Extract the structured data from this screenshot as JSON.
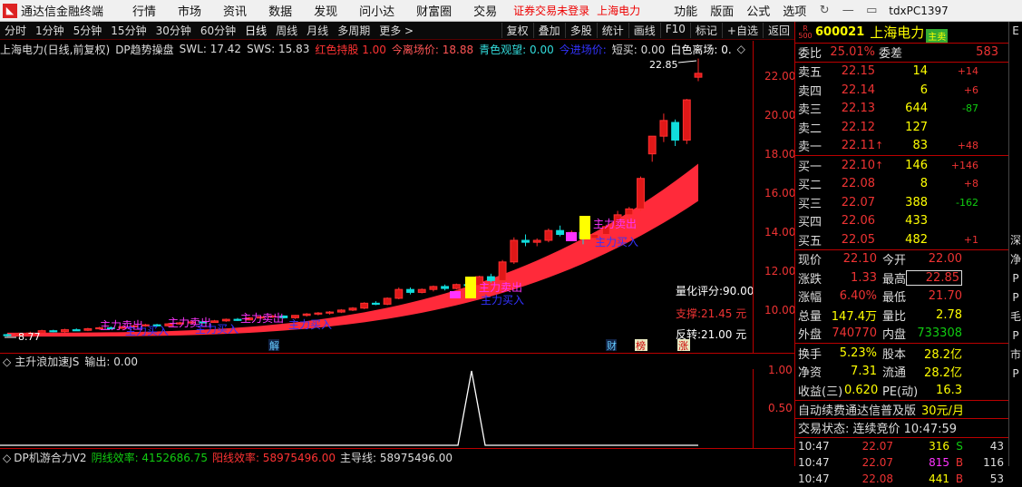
{
  "titlebar": {
    "app_title": "通达信金融终端",
    "menu": [
      "行情",
      "市场",
      "资讯",
      "数据",
      "发现",
      "问小达",
      "财富圈",
      "交易"
    ],
    "warn": "证券交易未登录",
    "stock": "上海电力",
    "right_menu": [
      "功能",
      "版面",
      "公式",
      "选项"
    ],
    "account": "tdxPC1397"
  },
  "timeframes": [
    "分时",
    "1分钟",
    "5分钟",
    "15分钟",
    "30分钟",
    "60分钟",
    "日线",
    "周线",
    "月线",
    "多周期",
    "更多 >"
  ],
  "active_timeframe": "日线",
  "toolbar_right": [
    "复权",
    "叠加",
    "多股",
    "统计",
    "画线",
    "F10",
    "标记",
    "+自选",
    "返回"
  ],
  "chart_info": {
    "name": "上海电力(日线,前复权)",
    "indicator": "DP趋势操盘",
    "swl": "SWL: 17.42",
    "sws": "SWS: 15.83",
    "red_hold": "红色持股  1.00",
    "exit_price": "今离场价: 18.88",
    "cyan_watch": "青色观望: 0.00",
    "entry": "今进场价: ",
    "short_buy": "短买: 0.00",
    "white_exit": "白色离场: 0."
  },
  "price_axis": [
    "22.00",
    "20.00",
    "18.00",
    "16.00",
    "14.00",
    "12.00",
    "10.00"
  ],
  "chart_labels": {
    "peak": "22.85",
    "low": "8.77",
    "score": "量化评分:90.00",
    "support": "支撑:21.45 元",
    "reversal": "反转:21.00 元",
    "main_sell": "主力卖出",
    "main_buy": "主力买入",
    "badges": [
      "解",
      "财",
      "榜",
      "涨"
    ]
  },
  "mid": {
    "name": "主升浪加速JS",
    "output": "输出: 0.00"
  },
  "sub_axis": [
    "1.00",
    "0.50"
  ],
  "bottom": {
    "name": "DP机游合力V2",
    "yin": "阴线效率: 4152686.75",
    "yang": "阳线效率: 58975496.00",
    "main": "主导线: 58975496.00"
  },
  "quote": {
    "r_badge": "R\n500",
    "code": "600021",
    "name": "上海电力",
    "tag": "主卖",
    "weibi_label": "委比",
    "weibi": "25.01%",
    "weicha_label": "委差",
    "weicha": "583",
    "asks": [
      {
        "label": "卖五",
        "price": "22.15",
        "vol": "14",
        "chg": "+14"
      },
      {
        "label": "卖四",
        "price": "22.14",
        "vol": "6",
        "chg": "+6"
      },
      {
        "label": "卖三",
        "price": "22.13",
        "vol": "644",
        "chg": "-87"
      },
      {
        "label": "卖二",
        "price": "22.12",
        "vol": "127",
        "chg": ""
      },
      {
        "label": "卖一",
        "price": "22.11",
        "vol": "83",
        "chg": "+48"
      }
    ],
    "bids": [
      {
        "label": "买一",
        "price": "22.10",
        "vol": "146",
        "chg": "+146"
      },
      {
        "label": "买二",
        "price": "22.08",
        "vol": "8",
        "chg": "+8"
      },
      {
        "label": "买三",
        "price": "22.07",
        "vol": "388",
        "chg": "-162"
      },
      {
        "label": "买四",
        "price": "22.06",
        "vol": "433",
        "chg": ""
      },
      {
        "label": "买五",
        "price": "22.05",
        "vol": "482",
        "chg": "+1"
      }
    ],
    "stats": [
      {
        "a": "现价",
        "b": "22.10",
        "c": "今开",
        "d": "22.00"
      },
      {
        "a": "涨跌",
        "b": "1.33",
        "c": "最高",
        "d": "22.85"
      },
      {
        "a": "涨幅",
        "b": "6.40%",
        "c": "最低",
        "d": "21.70"
      },
      {
        "a": "总量",
        "b": "147.4万",
        "c": "量比",
        "d": "2.78"
      },
      {
        "a": "外盘",
        "b": "740770",
        "c": "内盘",
        "d": "733308"
      }
    ],
    "stats2": [
      {
        "a": "换手",
        "b": "5.23%",
        "c": "股本",
        "d": "28.2亿"
      },
      {
        "a": "净资",
        "b": "7.31",
        "c": "流通",
        "d": "28.2亿"
      },
      {
        "a": "收益(三)",
        "b": "0.620",
        "c": "PE(动)",
        "d": "16.3"
      }
    ],
    "promo": "自动续费通达信普及版",
    "promo_price": "30元/月",
    "trade_status": "交易状态: 连续竞价 10:47:59",
    "ticks": [
      {
        "t": "10:47",
        "p": "22.07",
        "v": "316",
        "s": "S",
        "n": "43"
      },
      {
        "t": "10:47",
        "p": "22.07",
        "v": "815",
        "s": "B",
        "n": "116"
      },
      {
        "t": "10:47",
        "p": "22.08",
        "v": "441",
        "s": "B",
        "n": "53"
      }
    ]
  },
  "edge_chars": [
    "E",
    "",
    "",
    "",
    "",
    "",
    "",
    "",
    "",
    "",
    "",
    "深",
    "净",
    "P",
    "P",
    "毛",
    "P",
    "市",
    "P"
  ],
  "chart_data": {
    "type": "candlestick",
    "ylim": [
      8.4,
      23.0
    ],
    "candles": [
      [
        8.8,
        8.85,
        8.7,
        8.77
      ],
      [
        8.78,
        8.9,
        8.72,
        8.86
      ],
      [
        8.85,
        8.95,
        8.8,
        8.88
      ],
      [
        8.88,
        9.05,
        8.85,
        9.0
      ],
      [
        9.0,
        9.05,
        8.92,
        8.95
      ],
      [
        8.95,
        9.1,
        8.9,
        9.05
      ],
      [
        9.05,
        9.12,
        9.0,
        9.02
      ],
      [
        9.02,
        9.15,
        8.98,
        9.1
      ],
      [
        9.1,
        9.2,
        9.05,
        9.15
      ],
      [
        9.15,
        9.22,
        9.08,
        9.12
      ],
      [
        9.12,
        9.25,
        9.1,
        9.2
      ],
      [
        9.2,
        9.3,
        9.15,
        9.25
      ],
      [
        9.25,
        9.35,
        9.2,
        9.3
      ],
      [
        9.3,
        9.35,
        9.2,
        9.25
      ],
      [
        9.25,
        9.4,
        9.22,
        9.35
      ],
      [
        9.35,
        9.45,
        9.3,
        9.4
      ],
      [
        9.4,
        9.5,
        9.35,
        9.45
      ],
      [
        9.45,
        9.5,
        9.38,
        9.42
      ],
      [
        9.42,
        9.55,
        9.4,
        9.5
      ],
      [
        9.5,
        9.62,
        9.45,
        9.58
      ],
      [
        9.58,
        9.65,
        9.5,
        9.55
      ],
      [
        9.55,
        9.7,
        9.52,
        9.65
      ],
      [
        9.65,
        9.75,
        9.6,
        9.7
      ],
      [
        9.7,
        9.8,
        9.65,
        9.75
      ],
      [
        9.75,
        9.78,
        9.62,
        9.66
      ],
      [
        9.66,
        9.8,
        9.6,
        9.78
      ],
      [
        9.78,
        9.9,
        9.72,
        9.85
      ],
      [
        9.85,
        9.95,
        9.78,
        9.9
      ],
      [
        9.9,
        10.0,
        9.82,
        9.95
      ],
      [
        9.95,
        10.1,
        9.9,
        10.05
      ],
      [
        10.05,
        10.2,
        10.0,
        10.15
      ],
      [
        10.15,
        10.45,
        10.1,
        10.4
      ],
      [
        10.4,
        10.5,
        10.3,
        10.35
      ],
      [
        10.35,
        10.7,
        10.3,
        10.65
      ],
      [
        10.65,
        11.2,
        10.6,
        11.1
      ],
      [
        11.1,
        11.2,
        10.85,
        10.95
      ],
      [
        10.95,
        11.15,
        10.9,
        11.1
      ],
      [
        11.1,
        11.3,
        11.0,
        11.25
      ],
      [
        11.25,
        11.35,
        11.05,
        11.15
      ],
      [
        11.15,
        11.4,
        11.1,
        11.35
      ],
      [
        11.35,
        11.5,
        11.2,
        11.3
      ],
      [
        11.3,
        11.8,
        11.25,
        11.75
      ],
      [
        11.75,
        11.9,
        11.45,
        11.55
      ],
      [
        11.55,
        12.6,
        11.5,
        12.5
      ],
      [
        12.5,
        13.75,
        12.4,
        13.6
      ],
      [
        13.6,
        13.9,
        13.3,
        13.5
      ],
      [
        13.5,
        13.7,
        13.3,
        13.6
      ],
      [
        13.6,
        14.2,
        13.5,
        14.1
      ],
      [
        14.1,
        14.35,
        13.8,
        13.9
      ],
      [
        13.9,
        14.1,
        13.6,
        14.0
      ],
      [
        14.0,
        14.2,
        13.4,
        13.7
      ],
      [
        13.7,
        14.0,
        13.6,
        13.9
      ],
      [
        13.9,
        14.4,
        13.85,
        14.3
      ],
      [
        14.3,
        15.1,
        14.2,
        14.9
      ],
      [
        14.9,
        15.3,
        14.8,
        15.2
      ],
      [
        15.2,
        16.85,
        15.1,
        16.75
      ],
      [
        18.0,
        18.6,
        17.6,
        18.9
      ],
      [
        18.9,
        20.05,
        18.6,
        19.7
      ],
      [
        19.6,
        19.75,
        18.4,
        18.7
      ],
      [
        18.7,
        20.8,
        18.5,
        20.75
      ],
      [
        21.9,
        22.85,
        21.7,
        22.1
      ]
    ],
    "band_upper_end": 17.5,
    "band_lower_end": 15.6
  }
}
